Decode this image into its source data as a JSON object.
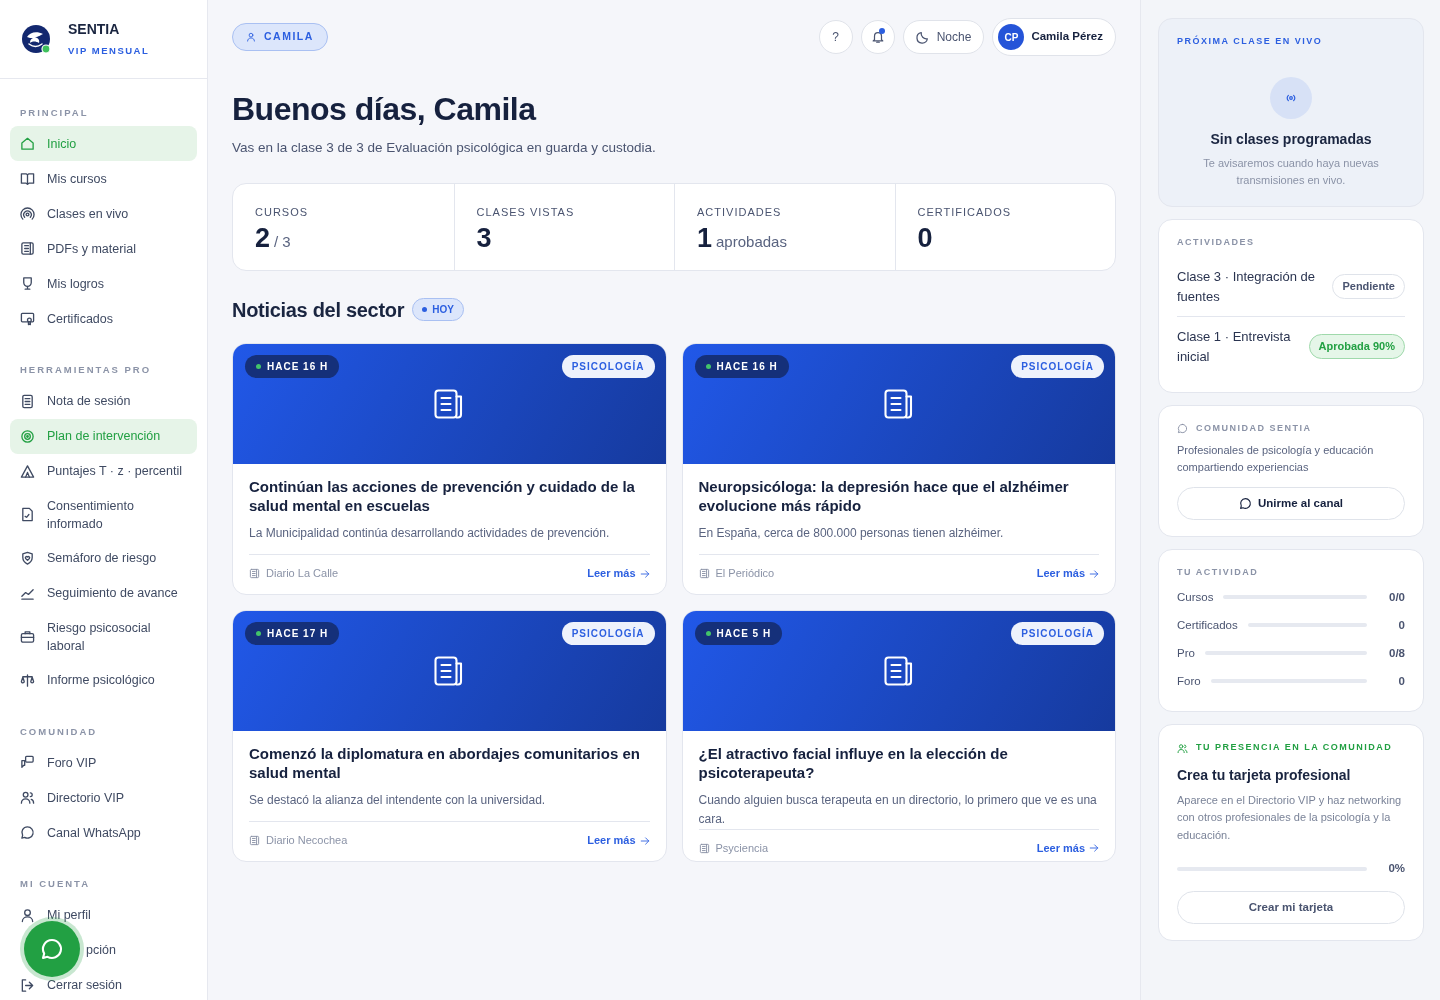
{
  "brand": {
    "name": "SENTIA",
    "plan": "VIP MENSUAL",
    "online": true
  },
  "sidebar": {
    "sections": [
      {
        "title": "PRINCIPAL",
        "items": [
          {
            "label": "Inicio",
            "selected": true
          },
          {
            "label": "Mis cursos",
            "selected": false
          },
          {
            "label": "Clases en vivo",
            "selected": false
          },
          {
            "label": "PDFs y material",
            "selected": false
          },
          {
            "label": "Mis logros",
            "selected": false
          },
          {
            "label": "Certificados",
            "selected": false
          }
        ]
      },
      {
        "title": "HERRAMIENTAS PRO",
        "items": [
          {
            "label": "Nota de sesión",
            "selected": false
          },
          {
            "label": "Plan de intervención",
            "selected": true
          },
          {
            "label": "Puntajes T · z · percentil",
            "selected": false
          },
          {
            "label": "Consentimiento informado",
            "selected": false
          },
          {
            "label": "Semáforo de riesgo",
            "selected": false
          },
          {
            "label": "Seguimiento de avance",
            "selected": false
          },
          {
            "label": "Riesgo psicosocial laboral",
            "selected": false
          },
          {
            "label": "Informe psicológico",
            "selected": false
          }
        ]
      },
      {
        "title": "COMUNIDAD",
        "items": [
          {
            "label": "Foro VIP",
            "selected": false
          },
          {
            "label": "Directorio VIP",
            "selected": false
          },
          {
            "label": "Canal WhatsApp",
            "selected": false
          }
        ]
      },
      {
        "title": "MI CUENTA",
        "items": [
          {
            "label": "Mi perfil",
            "selected": false
          },
          {
            "label": "pción",
            "selected": false,
            "kind": "covered"
          },
          {
            "label": "Cerrar sesión",
            "selected": false
          }
        ]
      }
    ]
  },
  "topbar": {
    "user_chip": "CAMILA",
    "help": "?",
    "notifications_unread": true,
    "theme_button": "Noche",
    "avatar_initials": "CP",
    "user_name": "Camila Pérez"
  },
  "greeting": {
    "title": "Buenos días, Camila",
    "subtitle": "Vas en la clase 3 de 3 de Evaluación psicológica en guarda y custodia."
  },
  "stats": [
    {
      "label": "CURSOS",
      "value": "2",
      "suffix": "/ 3"
    },
    {
      "label": "CLASES VISTAS",
      "value": "3"
    },
    {
      "label": "ACTIVIDADES",
      "value": "1",
      "suffix": "aprobadas"
    },
    {
      "label": "CERTIFICADOS",
      "value": "0"
    }
  ],
  "news": {
    "title": "Noticias del sector",
    "badge": "HOY",
    "items": [
      {
        "age": "HACE 16 H",
        "tag": "PSICOLOGÍA",
        "title": "Continúan las acciones de prevención y cuidado de la salud mental en escuelas",
        "summary": "La Municipalidad continúa desarrollando actividades de prevención.",
        "source": "Diario La Calle",
        "link": "Leer más"
      },
      {
        "age": "HACE 16 H",
        "tag": "PSICOLOGÍA",
        "title": "Neuropsicóloga: la depresión hace que el alzhéimer evolucione más rápido",
        "summary": "En España, cerca de 800.000 personas tienen alzhéimer.",
        "source": "El Periódico",
        "link": "Leer más"
      },
      {
        "age": "HACE 17 H",
        "tag": "PSICOLOGÍA",
        "title": "Comenzó la diplomatura en abordajes comunitarios en salud mental",
        "summary": "Se destacó la alianza del intendente con la universidad.",
        "source": "Diario Necochea",
        "link": "Leer más"
      },
      {
        "age": "HACE 5 H",
        "tag": "PSICOLOGÍA",
        "title": "¿El atractivo facial influye en la elección de psicoterapeuta?",
        "summary": "Cuando alguien busca terapeuta en un directorio, lo primero que ve es una cara.",
        "source": "Psyciencia",
        "link": "Leer más"
      }
    ]
  },
  "live": {
    "title": "PRÓXIMA CLASE EN VIVO",
    "empty_title": "Sin clases programadas",
    "empty_text": "Te avisaremos cuando haya nuevas transmisiones en vivo."
  },
  "activities": {
    "title": "ACTIVIDADES",
    "items": [
      {
        "label": "Clase 3 · Integración de fuentes",
        "status": "Pendiente",
        "kind": "pending"
      },
      {
        "label": "Clase 1 · Entrevista inicial",
        "status": "Aprobada 90%",
        "kind": "approved"
      }
    ]
  },
  "community": {
    "title": "COMUNIDAD SENTIA",
    "text": "Profesionales de psicología y educación compartiendo experiencias",
    "button": "Unirme al canal"
  },
  "my_activity": {
    "title": "TU ACTIVIDAD",
    "rows": [
      {
        "label": "Cursos",
        "level": 0,
        "reading": "0/0"
      },
      {
        "label": "Certificados",
        "level": 0,
        "reading": "0"
      },
      {
        "label": "Pro",
        "level": 0,
        "reading": "0/8"
      },
      {
        "label": "Foro",
        "level": 0,
        "reading": "0"
      }
    ]
  },
  "presence": {
    "title": "TU PRESENCIA EN LA COMUNIDAD",
    "heading": "Crea tu tarjeta profesional",
    "text": "Aparece en el Directorio VIP y haz networking con otros profesionales de la psicología y la educación.",
    "level": 0,
    "reading": "0%",
    "button": "Crear mi tarjeta"
  }
}
